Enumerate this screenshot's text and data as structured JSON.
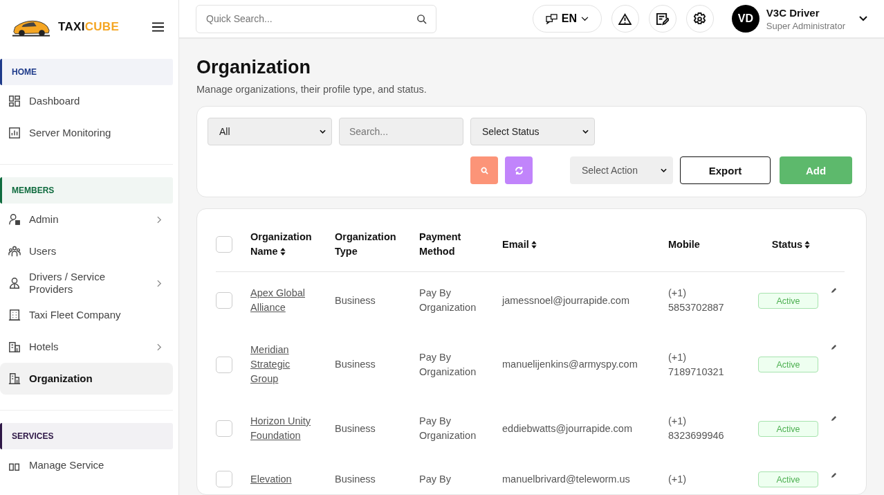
{
  "sidebar": {
    "logo": {
      "text_dark": "TAXI",
      "text_accent": "CUBE"
    },
    "sections": [
      {
        "title": "HOME",
        "color": "#1e3a8a",
        "items": [
          {
            "label": "Dashboard",
            "expandable": false,
            "selected": false
          },
          {
            "label": "Server Monitoring",
            "expandable": false,
            "selected": false
          }
        ]
      },
      {
        "title": "MEMBERS",
        "color": "#0f6b3e",
        "items": [
          {
            "label": "Admin",
            "expandable": true,
            "selected": false
          },
          {
            "label": "Users",
            "expandable": false,
            "selected": false
          },
          {
            "label": "Drivers / Service Providers",
            "expandable": true,
            "selected": false
          },
          {
            "label": "Taxi Fleet Company",
            "expandable": false,
            "selected": false
          },
          {
            "label": "Hotels",
            "expandable": true,
            "selected": false
          },
          {
            "label": "Organization",
            "expandable": false,
            "selected": true
          }
        ]
      },
      {
        "title": "SERVICES",
        "color": "#2e1746",
        "items": [
          {
            "label": "Manage Service",
            "expandable": false,
            "selected": false
          }
        ]
      }
    ]
  },
  "header": {
    "search": {
      "placeholder": "Quick Search..."
    },
    "language": "EN",
    "user": {
      "initials": "VD",
      "name": "V3C Driver",
      "role": "Super Administrator"
    }
  },
  "page": {
    "title": "Organization",
    "subtitle": "Manage organizations, their profile type, and status."
  },
  "filters": {
    "type_select": "All",
    "search": {
      "placeholder": "Search..."
    },
    "status_select": "Select Status",
    "action_select": "Select Action",
    "buttons": [
      "Export",
      "Add"
    ]
  },
  "table": {
    "select_all": {
      "checked": false
    },
    "columns": [
      {
        "label": "Organization Name",
        "sortable": true
      },
      {
        "label": "Organization Type",
        "sortable": false
      },
      {
        "label": "Payment Method",
        "sortable": false
      },
      {
        "label": "Email",
        "sortable": true
      },
      {
        "label": "Mobile",
        "sortable": false
      },
      {
        "label": "Status",
        "sortable": true
      }
    ],
    "rows": [
      {
        "checked": false,
        "name": "Apex Global Alliance",
        "type": "Business",
        "payment": "Pay By Organization",
        "email": "jamessnoel@jourrapide.com",
        "mobile": "(+1) 5853702887",
        "status": "Active",
        "active": true
      },
      {
        "checked": false,
        "name": "Meridian Strategic Group",
        "type": "Business",
        "payment": "Pay By Organization",
        "email": "manuelijenkins@armyspy.com",
        "mobile": "(+1) 7189710321",
        "status": "Active",
        "active": true
      },
      {
        "checked": false,
        "name": "Horizon Unity Foundation",
        "type": "Business",
        "payment": "Pay By Organization",
        "email": "eddiebwatts@jourrapide.com",
        "mobile": "(+1) 8323699946",
        "status": "Active",
        "active": true
      },
      {
        "checked": false,
        "name": "Elevation",
        "type": "Business",
        "payment": "Pay By",
        "email": "manuelbrivard@teleworm.us",
        "mobile": "(+1)",
        "status": "Active",
        "active": true
      }
    ]
  }
}
